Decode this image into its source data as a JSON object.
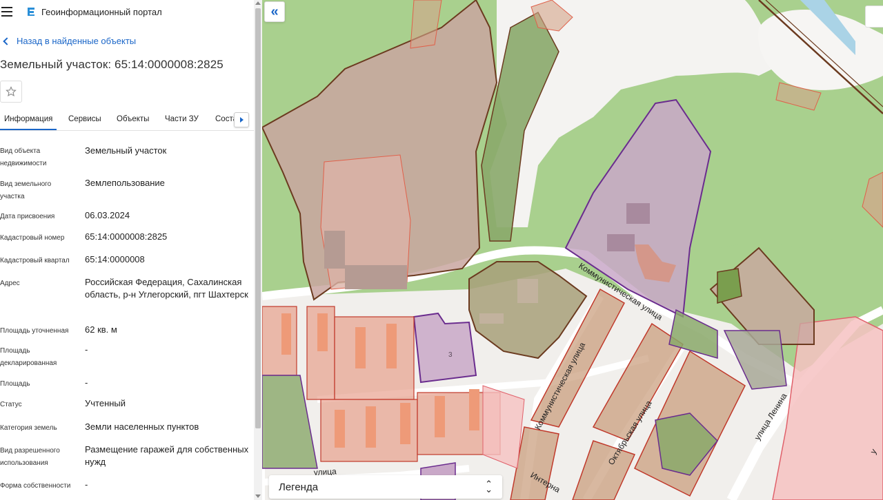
{
  "header": {
    "app_title": "Геоинформационный портал"
  },
  "nav": {
    "back_label": "Назад в найденные объекты"
  },
  "object": {
    "title": "Земельный участок: 65:14:0000008:2825"
  },
  "tabs": [
    {
      "label": "Информация"
    },
    {
      "label": "Сервисы"
    },
    {
      "label": "Объекты"
    },
    {
      "label": "Части ЗУ"
    },
    {
      "label": "Состав"
    }
  ],
  "info": [
    {
      "label": "Вид объекта недвижимости",
      "value": "Земельный участок"
    },
    {
      "label": "Вид земельного участка",
      "value": "Землепользование"
    },
    {
      "label": "Дата присвоения",
      "value": "06.03.2024"
    },
    {
      "label": "Кадастровый номер",
      "value": "65:14:0000008:2825"
    },
    {
      "label": "Кадастровый квартал",
      "value": "65:14:0000008"
    },
    {
      "label": "Адрес",
      "value": "Российская Федерация, Сахалинская область, р-н Углегорский, пгт Шахтерск"
    },
    {
      "label": "Площадь уточненная",
      "value": "62 кв. м"
    },
    {
      "label": "Площадь декларированная",
      "value": "-"
    },
    {
      "label": "Площадь",
      "value": "-"
    },
    {
      "label": "Статус",
      "value": "Учтенный"
    },
    {
      "label": "Категория земель",
      "value": "Земли населенных пунктов"
    },
    {
      "label": "Вид разрешенного использования",
      "value": "Размещение гаражей для собственных нужд"
    },
    {
      "label": "Форма собственности",
      "value": "-"
    }
  ],
  "map": {
    "streets": {
      "kommunisticheskaya_1": "Коммунистическая улица",
      "kommunisticheskaya_2": "Коммунистическая улица",
      "oktyabrskaya": "Октябрьская улица",
      "lenina": "улица Ленина",
      "bottom_left": "улица",
      "internatsionalnaya": "Интерна",
      "bottom_right": "у"
    },
    "parcel_number": "3"
  },
  "legend": {
    "label": "Легенда"
  },
  "colors": {
    "accent": "#1a66c8",
    "map_green": "#a9d08e",
    "parcel_red": "#e0604a"
  }
}
